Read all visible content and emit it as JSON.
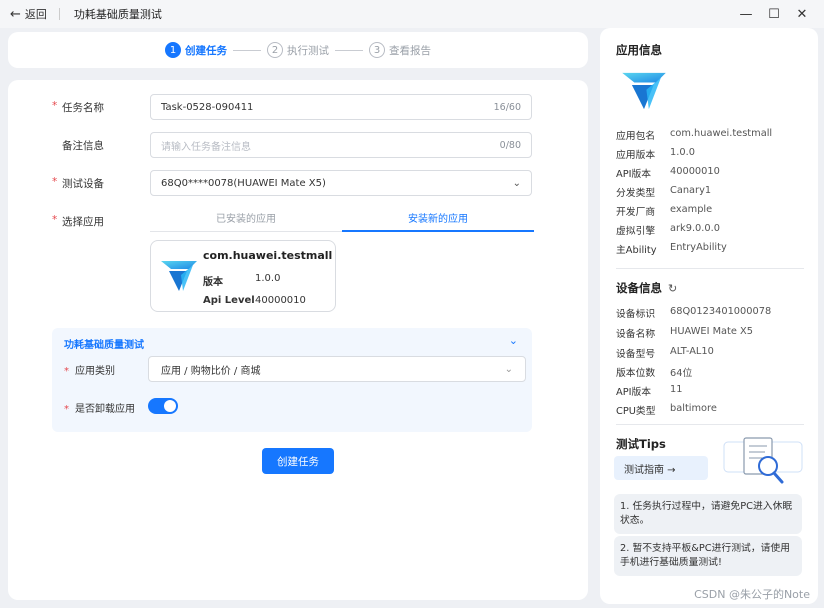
{
  "titlebar": {
    "back_label": "返回",
    "title": "功耗基础质量测试"
  },
  "stepper": {
    "steps": [
      {
        "num": "1",
        "label": "创建任务",
        "active": true
      },
      {
        "num": "2",
        "label": "执行测试",
        "active": false
      },
      {
        "num": "3",
        "label": "查看报告",
        "active": false
      }
    ]
  },
  "form": {
    "task_name": {
      "label": "任务名称",
      "value": "Task-0528-090411",
      "count": "16/60"
    },
    "remark": {
      "label": "备注信息",
      "placeholder": "请输入任务备注信息",
      "count": "0/80"
    },
    "device": {
      "label": "测试设备",
      "value": "68Q0****0078(HUAWEI Mate X5)"
    },
    "app_select": {
      "label": "选择应用",
      "tabs": [
        "已安装的应用",
        "安装新的应用"
      ],
      "active_tab": 1
    },
    "app_card": {
      "package": "com.huawei.testmall",
      "version_key": "版本",
      "version_value": "1.0.0",
      "api_key": "Api Level",
      "api_value": "40000010"
    },
    "panel": {
      "title": "功耗基础质量测试",
      "category_label": "应用类别",
      "category_value": "应用 / 购物比价 / 商城",
      "uninstall_label": "是否卸载应用",
      "uninstall_on": true
    },
    "create_button": "创建任务"
  },
  "app_info": {
    "title": "应用信息",
    "items": [
      {
        "k": "应用包名",
        "v": "com.huawei.testmall"
      },
      {
        "k": "应用版本",
        "v": "1.0.0"
      },
      {
        "k": "API版本",
        "v": "40000010"
      },
      {
        "k": "分发类型",
        "v": "Canary1"
      },
      {
        "k": "开发厂商",
        "v": "example"
      },
      {
        "k": "虚拟引擎",
        "v": "ark9.0.0.0"
      },
      {
        "k": "主Ability",
        "v": "EntryAbility"
      }
    ]
  },
  "device_info": {
    "title": "设备信息",
    "items": [
      {
        "k": "设备标识",
        "v": "68Q0123401000078"
      },
      {
        "k": "设备名称",
        "v": "HUAWEI Mate X5"
      },
      {
        "k": "设备型号",
        "v": "ALT-AL10"
      },
      {
        "k": "版本位数",
        "v": "64位"
      },
      {
        "k": "API版本",
        "v": "11"
      },
      {
        "k": "CPU类型",
        "v": "baltimore"
      }
    ]
  },
  "tips": {
    "title": "测试Tips",
    "guide_button": "测试指南 →",
    "items": [
      "1. 任务执行过程中，请避免PC进入休眠状态。",
      "2. 暂不支持平板&PC进行测试，请使用手机进行基础质量测试!"
    ]
  },
  "watermark": "CSDN @朱公子的Note",
  "colors": {
    "accent": "#1677ff",
    "required": "#e5484d"
  }
}
